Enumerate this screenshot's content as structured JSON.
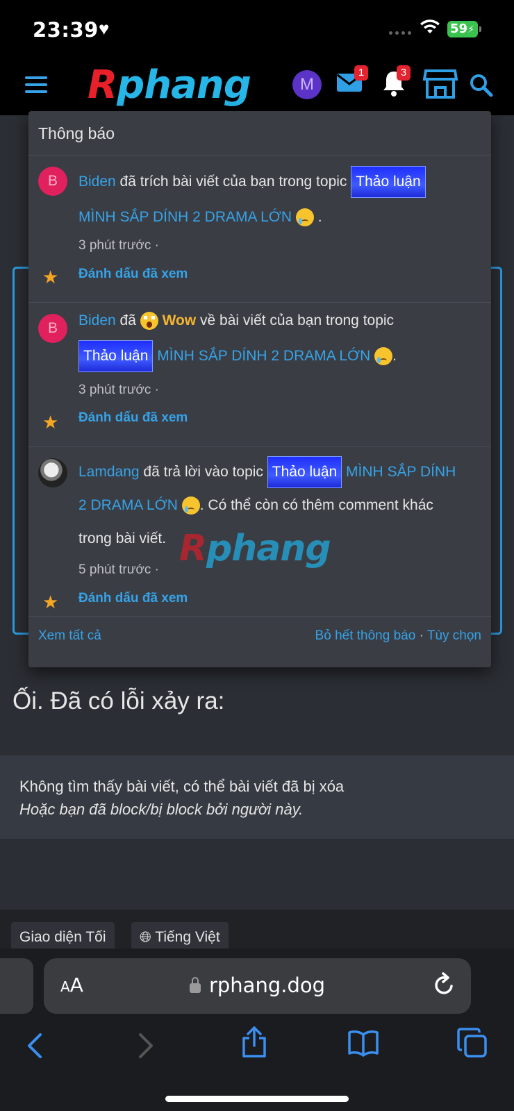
{
  "status_bar": {
    "time": "23:39",
    "battery": "59"
  },
  "header": {
    "logo_first": "R",
    "logo_rest": "phang",
    "avatar_letter": "M",
    "messages_badge": "1",
    "alerts_badge": "3"
  },
  "popup": {
    "title": "Thông báo",
    "notifications": [
      {
        "avatar": "B",
        "user": "Biden",
        "text_before_tag": " đã trích bài viết của bạn trong topic ",
        "tag": "Thảo luận",
        "thread": "MÌNH SẮP DÍNH 2 DRAMA LỚN",
        "time": "3 phút trước ·",
        "mark": "Đánh dấu đã xem"
      },
      {
        "avatar": "B",
        "user": "Biden",
        "text_a": " đã ",
        "reaction": "Wow",
        "text_b": " về bài viết của bạn trong topic",
        "tag": "Thảo luận",
        "thread": "MÌNH SẮP DÍNH 2 DRAMA LỚN",
        "time": "3 phút trước ·",
        "mark": "Đánh dấu đã xem"
      },
      {
        "user": "Lamdang",
        "text_before_tag": " đã trả lời vào topic ",
        "tag": "Thảo luận",
        "thread_a": "MÌNH SẮP DÍNH",
        "thread_b": "2 DRAMA LỚN",
        "text_after": ". Có thể còn có thêm comment khác",
        "text_after2": "trong bài viết.",
        "time": "5 phút trước ·",
        "mark": "Đánh dấu đã xem"
      }
    ],
    "footer": {
      "see_all": "Xem tất cả",
      "clear_all": "Bỏ hết thông báo",
      "options": "Tùy chọn"
    }
  },
  "watermark": {
    "first": "R",
    "rest": "phang"
  },
  "page": {
    "error_title": "Ối. Đã có lỗi xảy ra:",
    "error_line1": "Không tìm thấy bài viết, có thể bài viết đã bị xóa",
    "error_line2": "Hoặc bạn đã block/bị block bởi người này.",
    "theme_chip": "Giao diện Tối",
    "lang_chip": "Tiếng Việt"
  },
  "browser": {
    "aa": "AA",
    "url": "rphang.dog"
  },
  "colors": {
    "accent": "#36a3e8",
    "brand_red": "#e8202a",
    "star": "#f5a623",
    "tag_blue": "#2f45ff"
  }
}
